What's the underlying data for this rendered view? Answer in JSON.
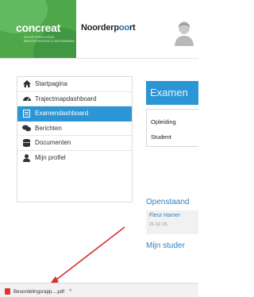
{
  "header": {
    "logo_text": "concreat",
    "logo_subtext": "ROOSTERSTUDIO · BEROEPSPRAKTIJKVORMING",
    "school_logo_left": "Noorderp",
    "school_logo_accent": "oo",
    "school_logo_right": "rt"
  },
  "sidebar": {
    "items": [
      {
        "label": "Startpagina",
        "icon": "home-icon",
        "active": false
      },
      {
        "label": "Trajectmapdashboard",
        "icon": "dashboard-icon",
        "active": false
      },
      {
        "label": "Examendashboard",
        "icon": "exam-icon",
        "active": true
      },
      {
        "label": "Berichten",
        "icon": "messages-icon",
        "active": false
      },
      {
        "label": "Documenten",
        "icon": "documents-icon",
        "active": false
      },
      {
        "label": "Mijn profiel",
        "icon": "user-icon",
        "active": false
      }
    ]
  },
  "main": {
    "title": "Examen",
    "info_labels": [
      "Opleiding",
      "Student"
    ],
    "section_open": "Openstaand",
    "open_item": {
      "name": "Fleur Hamer",
      "date": "21-12-'21"
    },
    "section_students": "Mijn studer"
  },
  "download_bar": {
    "file_name": "Beoordelingsrapp....pdf",
    "caret": "^"
  },
  "colors": {
    "accent": "#2c95d3",
    "brand_green": "#4ea84a",
    "arrow": "#d8322f"
  }
}
